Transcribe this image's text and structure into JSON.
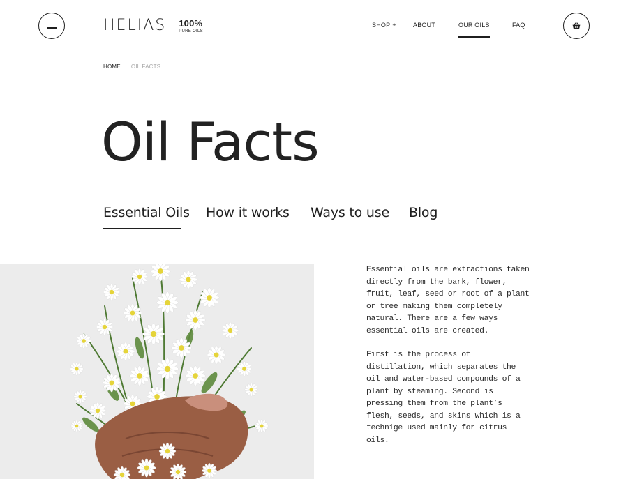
{
  "header": {
    "menu_icon": "hamburger-icon",
    "logo": {
      "word": "HELIAS",
      "percent": "100%",
      "sub": "PURE OILS"
    },
    "nav": [
      {
        "label": "SHOP",
        "suffix": "+"
      },
      {
        "label": "ABOUT"
      },
      {
        "label": "OUR OILS",
        "active": true
      },
      {
        "label": "FAQ"
      }
    ],
    "cart_icon": "basket-icon"
  },
  "breadcrumb": {
    "home": "HOME",
    "current": "OIL FACTS"
  },
  "page": {
    "title": "Oil Facts"
  },
  "tabs": [
    {
      "label": "Essential Oils",
      "active": true
    },
    {
      "label": "How it works"
    },
    {
      "label": "Ways to use"
    },
    {
      "label": "Blog"
    }
  ],
  "content": {
    "paragraphs": [
      "Essential oils are extractions taken directly from the bark, flower, fruit, leaf, seed or root of a plant or tree making them completely natural. There are a few ways essential oils are created.",
      "First is the process of distillation, which separates the oil and water-based compounds of a plant by steaming. Second is pressing them from the plant’s flesh, seeds, and skins which is a technige used mainly for citrus oils."
    ],
    "image_subject": "daisy-bouquet-in-hand"
  },
  "colors": {
    "text": "#1f1f1f",
    "muted": "#a9a9a9",
    "hero_bg": "#ececec",
    "stem_green": "#4f7a34",
    "petal": "#ffffff",
    "flower_center": "#e5d43a",
    "skin": "#9a5e44"
  }
}
